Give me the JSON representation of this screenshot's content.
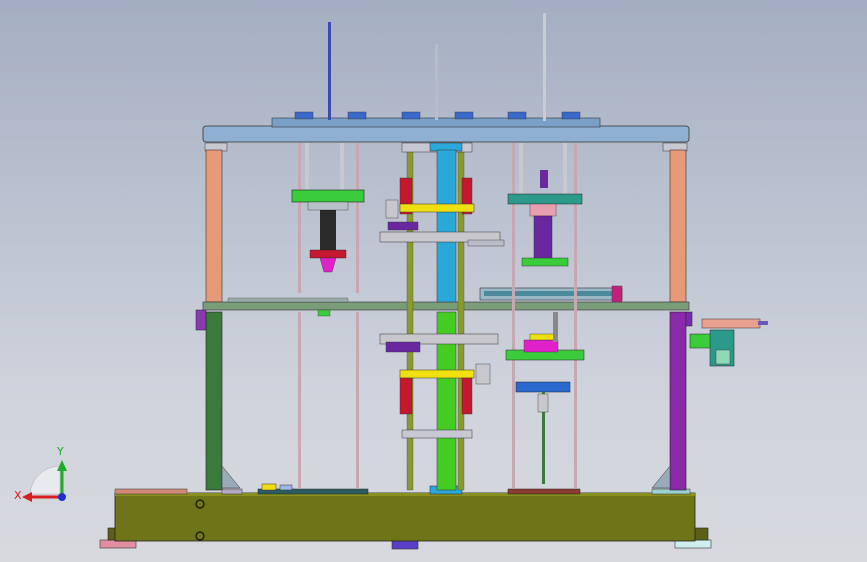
{
  "view": {
    "background_top": "#a4aec2",
    "background_bottom": "#d7d9de"
  },
  "triad": {
    "x_label": "X",
    "y_label": "Y",
    "x_color": "#d62020",
    "y_color": "#1faa2a",
    "z_color": "#1f2fd0"
  },
  "model": {
    "base_color": "#6f7418",
    "frame_color": "#8fb0d0",
    "post_left_upper": "#e89a78",
    "post_left_lower": "#3a7a3a",
    "post_right_upper": "#e89a78",
    "post_right_lower": "#8a2aa8",
    "center_column": "#2aa8d8",
    "center_column_lower": "#44cc22",
    "accent_pink": "#e020c8",
    "accent_yellow": "#f0e010",
    "accent_red": "#c41830",
    "accent_purple": "#6a28a0",
    "accent_teal": "#2c9a8a"
  }
}
